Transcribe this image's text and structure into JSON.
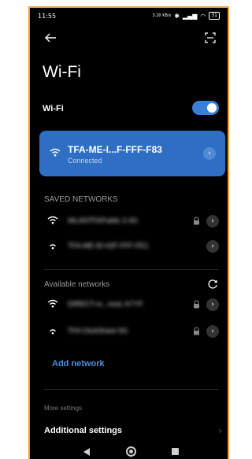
{
  "status_bar": {
    "time": "11:55",
    "net_speed": "3.20 KB/s",
    "battery": "31"
  },
  "header": {
    "title": "Wi-Fi"
  },
  "wifi_toggle": {
    "label": "Wi-Fi",
    "enabled": true
  },
  "connected": {
    "name": "TFA-ME-I...F-FFF-F83",
    "status": "Connected"
  },
  "saved": {
    "header": "SAVED NETWORKS",
    "items": [
      {
        "name": "WLANTFAPublic 2.4G",
        "secured": true
      },
      {
        "name": "TFA-ME-ID-02F-FFF-FE1",
        "secured": false
      }
    ]
  },
  "available": {
    "header": "Available networks",
    "items": [
      {
        "name": "DIRECT-m...nosL-K7YF",
        "secured": true
      },
      {
        "name": "TFA ClickShare 5G",
        "secured": true
      }
    ]
  },
  "add_network": "Add network",
  "more_settings": {
    "header": "More settings",
    "item": "Additional settings"
  },
  "colors": {
    "accent": "#2f6fc3",
    "toggle_on": "#3a7fd6",
    "link": "#4a90e2",
    "background": "#000000"
  }
}
